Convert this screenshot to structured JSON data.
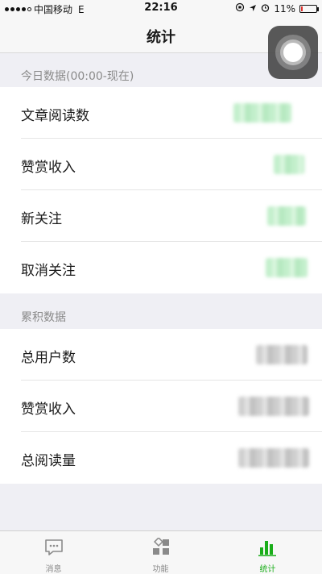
{
  "status_bar": {
    "carrier": "中国移动",
    "network": "E",
    "time": "22:16",
    "battery": "11%",
    "battery_level": 0.11
  },
  "nav": {
    "title": "统计"
  },
  "today": {
    "header": "今日数据(00:00-现在)",
    "rows": [
      {
        "label": "文章阅读数"
      },
      {
        "label": "赞赏收入"
      },
      {
        "label": "新关注"
      },
      {
        "label": "取消关注"
      }
    ]
  },
  "cumulative": {
    "header": "累积数据",
    "rows": [
      {
        "label": "总用户数"
      },
      {
        "label": "赞赏收入"
      },
      {
        "label": "总阅读量"
      }
    ]
  },
  "tabs": [
    {
      "label": "消息",
      "icon": "message-icon",
      "active": false
    },
    {
      "label": "功能",
      "icon": "grid-icon",
      "active": false
    },
    {
      "label": "统计",
      "icon": "bar-chart-icon",
      "active": true
    }
  ],
  "colors": {
    "accent": "#1aad19",
    "inactive": "#8a8a8a",
    "background": "#efeff4",
    "battery_low": "#e0302b"
  }
}
